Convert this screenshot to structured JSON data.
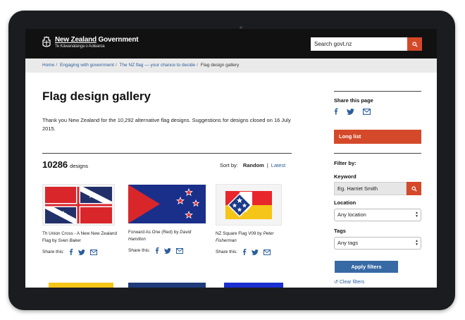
{
  "header": {
    "gov_name_part1": "New Zealand",
    "gov_name_part2": " Government",
    "gov_subtitle": "Te Kāwanatanga o Aotearoa",
    "search_value": "Search govt.nz"
  },
  "breadcrumb": [
    {
      "label": "Home"
    },
    {
      "label": "Engaging with government"
    },
    {
      "label": "The NZ flag — your chance to decide"
    },
    {
      "label": "Flag design gallery"
    }
  ],
  "page": {
    "title": "Flag design gallery",
    "intro": "Thank you New Zealand for the 10,292 alternative flag designs. Suggestions for designs closed on 16 July 2015."
  },
  "results": {
    "count": "10286",
    "count_label": "designs",
    "sort_label": "Sort by:",
    "sort_random": "Random",
    "sort_sep": "|",
    "sort_latest": "Latest"
  },
  "cards": [
    {
      "title": "Th Union Cross - A New New Zealand Flag",
      "by": " by ",
      "author": "Sven Baker",
      "share_label": "Share this:"
    },
    {
      "title": "Forward As One (Red)",
      "by": " by ",
      "author": "David Hamilton",
      "share_label": "Share this:"
    },
    {
      "title": "NZ Square Flag V09",
      "by": " by ",
      "author": "Peter Fisherman",
      "share_label": "Share this:"
    }
  ],
  "sidebar": {
    "share_title": "Share this page",
    "long_list": "Long list",
    "filter_title": "Filter by:",
    "keyword_label": "Keyword",
    "keyword_value": "Eg. Harriet Smith",
    "location_label": "Location",
    "location_value": "Any location",
    "tags_label": "Tags",
    "tags_value": "Any tags",
    "apply_label": "Apply filters",
    "clear_label": "Clear filters"
  },
  "colors": {
    "accent": "#d4492a",
    "link": "#2a5d9c",
    "button": "#376aa5",
    "header_bg": "#111111"
  }
}
